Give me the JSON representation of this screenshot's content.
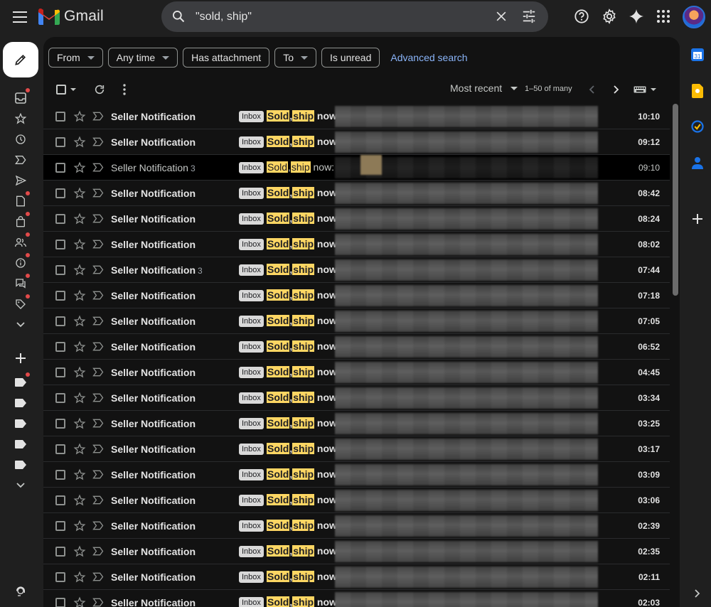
{
  "header": {
    "app_name": "Gmail",
    "search_value": "\"sold, ship\""
  },
  "filters": {
    "chips": [
      "From",
      "Any time",
      "Has attachment",
      "To",
      "Is unread"
    ],
    "advanced_search": "Advanced search"
  },
  "toolbar": {
    "sort_label": "Most recent",
    "count_label": "1–50 of many"
  },
  "emails": [
    {
      "sender": "Seller Notification",
      "thread": "",
      "label": "Inbox",
      "w1": "Sold",
      "sep": ",",
      "w2": "ship",
      "rest": " now:",
      "time": "10:10",
      "read": false
    },
    {
      "sender": "Seller Notification",
      "thread": "",
      "label": "Inbox",
      "w1": "Sold",
      "sep": ",",
      "w2": "ship",
      "rest": " now:",
      "time": "09:12",
      "read": false
    },
    {
      "sender": "Seller Notification",
      "thread": "3",
      "label": "Inbox",
      "w1": "Sold",
      "sep": ",",
      "w2": "ship",
      "rest": " now: 2",
      "time": "09:10",
      "read": true
    },
    {
      "sender": "Seller Notification",
      "thread": "",
      "label": "Inbox",
      "w1": "Sold",
      "sep": ",",
      "w2": "ship",
      "rest": " now:",
      "time": "08:42",
      "read": false
    },
    {
      "sender": "Seller Notification",
      "thread": "",
      "label": "Inbox",
      "w1": "Sold",
      "sep": ",",
      "w2": "ship",
      "rest": " now:",
      "time": "08:24",
      "read": false
    },
    {
      "sender": "Seller Notification",
      "thread": "",
      "label": "Inbox",
      "w1": "Sold",
      "sep": ",",
      "w2": "ship",
      "rest": " now:",
      "time": "08:02",
      "read": false
    },
    {
      "sender": "Seller Notification",
      "thread": "3",
      "label": "Inbox",
      "w1": "Sold",
      "sep": ",",
      "w2": "ship",
      "rest": " now:",
      "time": "07:44",
      "read": false
    },
    {
      "sender": "Seller Notification",
      "thread": "",
      "label": "Inbox",
      "w1": "Sold",
      "sep": ",",
      "w2": "ship",
      "rest": " now:",
      "time": "07:18",
      "read": false
    },
    {
      "sender": "Seller Notification",
      "thread": "",
      "label": "Inbox",
      "w1": "Sold",
      "sep": ",",
      "w2": "ship",
      "rest": " now:",
      "time": "07:05",
      "read": false
    },
    {
      "sender": "Seller Notification",
      "thread": "",
      "label": "Inbox",
      "w1": "Sold",
      "sep": ",",
      "w2": "ship",
      "rest": " now:",
      "time": "06:52",
      "read": false
    },
    {
      "sender": "Seller Notification",
      "thread": "",
      "label": "Inbox",
      "w1": "Sold",
      "sep": ",",
      "w2": "ship",
      "rest": " now:",
      "time": "04:45",
      "read": false
    },
    {
      "sender": "Seller Notification",
      "thread": "",
      "label": "Inbox",
      "w1": "Sold",
      "sep": ",",
      "w2": "ship",
      "rest": " now:",
      "time": "03:34",
      "read": false
    },
    {
      "sender": "Seller Notification",
      "thread": "",
      "label": "Inbox",
      "w1": "Sold",
      "sep": ",",
      "w2": "ship",
      "rest": " now:",
      "time": "03:25",
      "read": false
    },
    {
      "sender": "Seller Notification",
      "thread": "",
      "label": "Inbox",
      "w1": "Sold",
      "sep": ",",
      "w2": "ship",
      "rest": " now:",
      "time": "03:17",
      "read": false
    },
    {
      "sender": "Seller Notification",
      "thread": "",
      "label": "Inbox",
      "w1": "Sold",
      "sep": ",",
      "w2": "ship",
      "rest": " now:",
      "time": "03:09",
      "read": false
    },
    {
      "sender": "Seller Notification",
      "thread": "",
      "label": "Inbox",
      "w1": "Sold",
      "sep": ",",
      "w2": "ship",
      "rest": " now:",
      "time": "03:06",
      "read": false
    },
    {
      "sender": "Seller Notification",
      "thread": "",
      "label": "Inbox",
      "w1": "Sold",
      "sep": ",",
      "w2": "ship",
      "rest": " now:",
      "time": "02:39",
      "read": false
    },
    {
      "sender": "Seller Notification",
      "thread": "",
      "label": "Inbox",
      "w1": "Sold",
      "sep": ",",
      "w2": "ship",
      "rest": " now:",
      "time": "02:35",
      "read": false
    },
    {
      "sender": "Seller Notification",
      "thread": "",
      "label": "Inbox",
      "w1": "Sold",
      "sep": ",",
      "w2": "ship",
      "rest": " now:",
      "time": "02:11",
      "read": false
    },
    {
      "sender": "Seller Notification",
      "thread": "",
      "label": "Inbox",
      "w1": "Sold",
      "sep": ",",
      "w2": "ship",
      "rest": " now:",
      "time": "02:03",
      "read": false
    }
  ],
  "colors": {
    "highlight": "#fdd663",
    "link": "#8ab4f8",
    "notification_dot": "#e24a4a"
  }
}
